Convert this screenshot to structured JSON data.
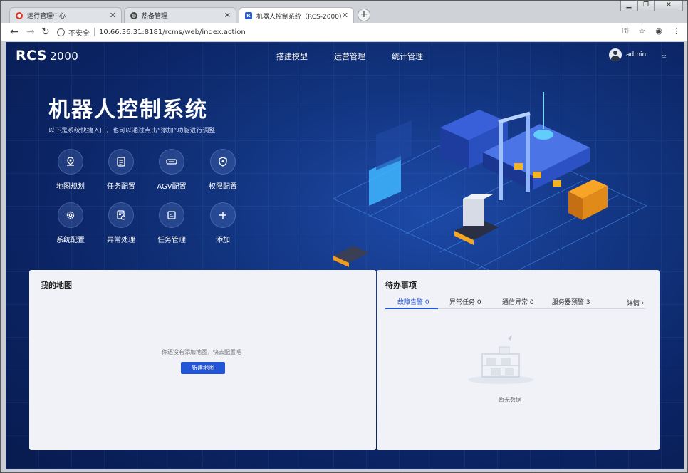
{
  "browser": {
    "tabs": [
      {
        "title": "运行管理中心",
        "icon_color": "#d6352a"
      },
      {
        "title": "热备管理",
        "icon_color": "#444444"
      },
      {
        "title": "机器人控制系统（RCS-2000）",
        "icon_color": "#2a5bd7"
      }
    ],
    "new_tab_label": "+",
    "window_buttons": [
      "▁",
      "❐",
      "✕"
    ],
    "url_security": "不安全",
    "url": "10.66.36.31:8181/rcms/web/index.action",
    "tab_close": "✕"
  },
  "app": {
    "logo_text": "RCS",
    "logo_number": "2000",
    "nav": [
      "搭建模型",
      "运营管理",
      "统计管理"
    ],
    "user": "admin",
    "hero_title": "机器人控制系统",
    "hero_subtitle": "以下是系统快捷入口，也可以通过点击“添加”功能进行调整",
    "quick_links": [
      {
        "label": "地图规划",
        "icon": "map-pin-icon"
      },
      {
        "label": "任务配置",
        "icon": "task-config-icon"
      },
      {
        "label": "AGV配置",
        "icon": "agv-icon"
      },
      {
        "label": "权限配置",
        "icon": "shield-icon"
      },
      {
        "label": "系统配置",
        "icon": "gear-icon"
      },
      {
        "label": "异常处理",
        "icon": "exception-icon"
      },
      {
        "label": "任务管理",
        "icon": "task-manage-icon"
      },
      {
        "label": "添加",
        "icon": "plus-icon"
      }
    ],
    "my_map": {
      "title": "我的地图",
      "empty_text": "你还没有添加地图，快去配置吧",
      "button": "新建地图"
    },
    "todo": {
      "title": "待办事项",
      "tabs": [
        "故障告警 0",
        "异常任务 0",
        "通信异常 0",
        "服务器预警 3"
      ],
      "details": "详情 ›",
      "empty_text": "暂无数据"
    }
  },
  "colors": {
    "accent": "#2356d6",
    "hero_bg": "#12347f"
  }
}
